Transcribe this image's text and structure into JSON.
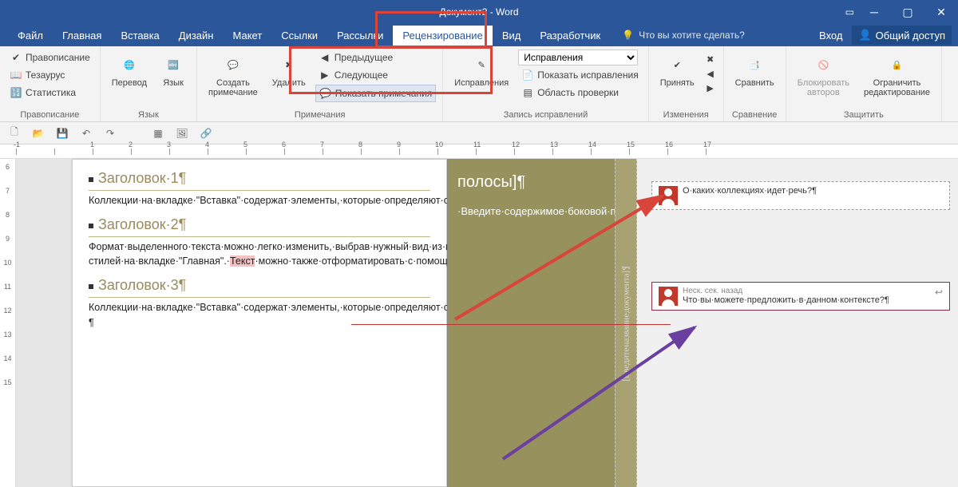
{
  "title": "Документ2 - Word",
  "menu": {
    "file": "Файл",
    "home": "Главная",
    "insert": "Вставка",
    "design": "Дизайн",
    "layout": "Макет",
    "references": "Ссылки",
    "mailings": "Рассылки",
    "review": "Рецензирование",
    "view": "Вид",
    "developer": "Разработчик",
    "tellme": "Что вы хотите сделать?",
    "signin": "Вход",
    "share": "Общий доступ"
  },
  "ribbon": {
    "proofing": {
      "spell": "Правописание",
      "thesaurus": "Тезаурус",
      "stats": "Статистика",
      "label": "Правописание"
    },
    "language": {
      "translate": "Перевод",
      "lang": "Язык",
      "label": "Язык"
    },
    "comments": {
      "new": "Создать\nпримечание",
      "delete": "Удалить",
      "prev": "Предыдущее",
      "next": "Следующее",
      "show": "Показать примечания",
      "label": "Примечания"
    },
    "tracking": {
      "track": "Исправления",
      "combo": "Исправления",
      "showmarkup": "Показать исправления",
      "pane": "Область проверки",
      "label": "Запись исправлений"
    },
    "changes": {
      "accept": "Принять",
      "label": "Изменения"
    },
    "compare": {
      "compare": "Сравнить",
      "label": "Сравнение"
    },
    "protect": {
      "block": "Блокировать\nавторов",
      "restrict": "Ограничить\nредактирование",
      "label": "Защитить"
    }
  },
  "ruler": [
    "-1",
    "",
    "1",
    "2",
    "3",
    "4",
    "5",
    "6",
    "7",
    "8",
    "9",
    "10",
    "11",
    "12",
    "13",
    "14",
    "15",
    "16",
    "17"
  ],
  "vruler": [
    "6",
    "7",
    "8",
    "9",
    "10",
    "11",
    "12",
    "13",
    "14",
    "15"
  ],
  "doc": {
    "h1": "Заголовок·1¶",
    "p1": "Коллекции·на·вкладке·\"Вставка\"·содержат·элементы,·которые·определяют·общий·вид·документа.·Эти·коллекции·служат·для·вставки·в·документ·таблиц,·колонтитулов,·списков,·титульных·страниц·и·других·стандартных·блоков.¶",
    "h2": "Заголовок·2¶",
    "p2a": "Формат·выделенного·текста·можно·легко·изменить,·выбрав·нужный·вид·из·коллекции·экспресс-стилей·на·вкладке·\"Главная\".·",
    "p2hl": "Текст",
    "p2b": "·можно·также·отформатировать·с·помощью·других·элементов·управления·на·вкладке·\"Главная\".·¶",
    "h3": "Заголовок·3¶",
    "p3": "Коллекции·на·вкладке·\"Вставка\"·содержат·элементы,·которые·определяют·общий·вид·документа.·Эти·коллекции·служат·для·вставки·в·документ·таблиц,·колонтитулов,·списков,·титульных·страниц·и·других·стандартных·блоков.¶",
    "last": "¶"
  },
  "sidebar": {
    "title": "полосы]¶",
    "body": "·Введите·содержимое·боковой·полосы.·Боковая·полоса·представляет·собой·независимое·дополнение·к·основному·документу.·Обычно·она·выровнена·по·левому·или·правому·краю·",
    "placeholder": "[Введите·название·документа]¶"
  },
  "comments_list": [
    {
      "text": "О·каких·коллекциях·идет·речь?¶",
      "meta": ""
    },
    {
      "text": "Что·вы·можете·предложить·в·данном·контексте?¶",
      "meta": "Неск. сек. назад"
    }
  ]
}
